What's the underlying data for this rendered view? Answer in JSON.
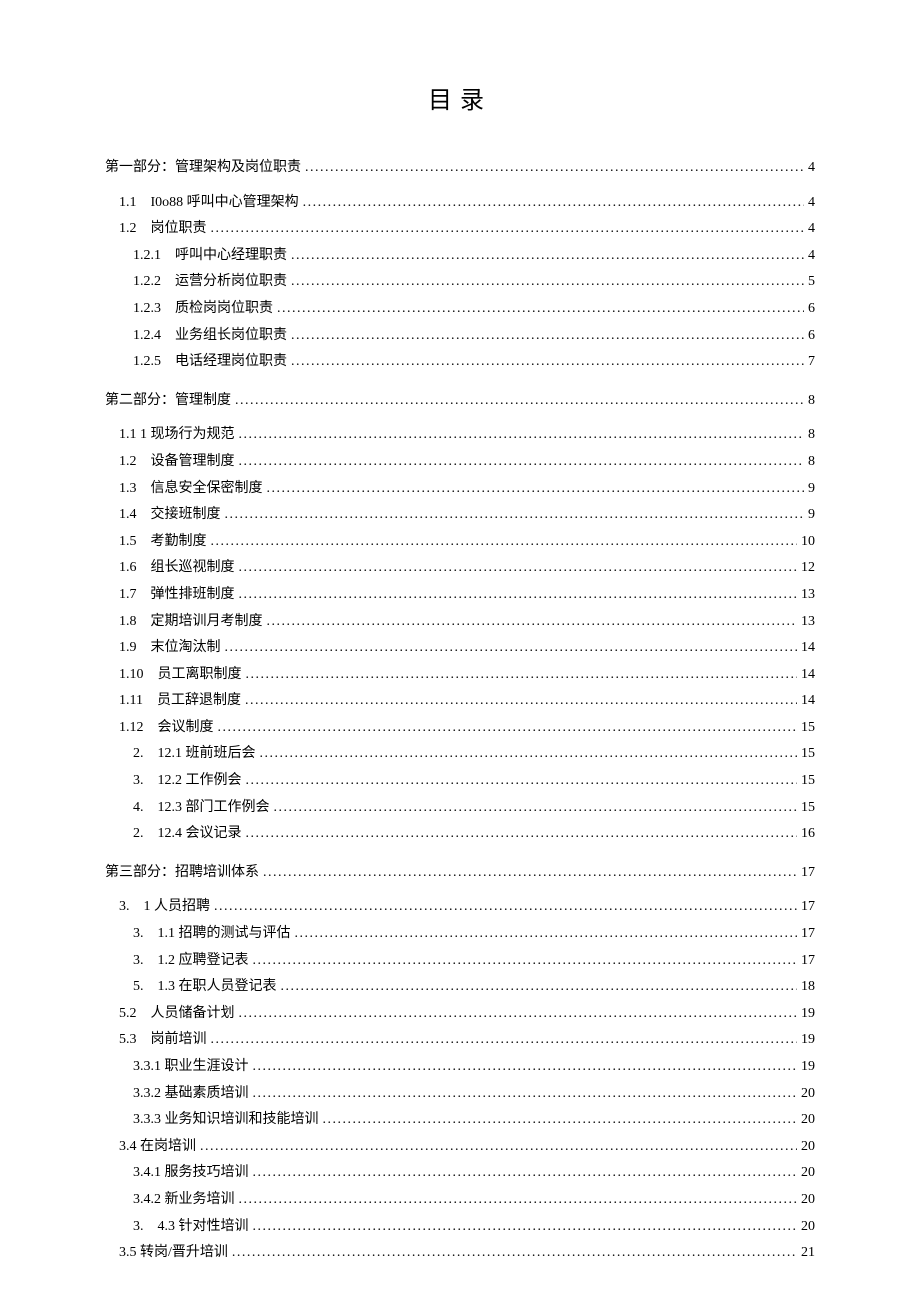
{
  "title": "目录",
  "toc": [
    {
      "level": 0,
      "label": "第一部分：管理架构及岗位职责",
      "page": "4"
    },
    {
      "level": 1,
      "label": "1.1　I0o88 呼叫中心管理架构",
      "page": "4"
    },
    {
      "level": 1,
      "label": "1.2　岗位职责",
      "page": "4"
    },
    {
      "level": 2,
      "label": "1.2.1　呼叫中心经理职责",
      "page": "4"
    },
    {
      "level": 2,
      "label": "1.2.2　运营分析岗位职责",
      "page": "5"
    },
    {
      "level": 2,
      "label": "1.2.3　质检岗岗位职责",
      "page": "6"
    },
    {
      "level": 2,
      "label": "1.2.4　业务组长岗位职责",
      "page": "6"
    },
    {
      "level": 2,
      "label": "1.2.5　电话经理岗位职责",
      "page": "7"
    },
    {
      "level": 0,
      "label": "第二部分：管理制度",
      "page": "8"
    },
    {
      "level": 1,
      "label": "1.1 1 现场行为规范",
      "page": "8"
    },
    {
      "level": 1,
      "label": "1.2　设备管理制度",
      "page": "8"
    },
    {
      "level": 1,
      "label": "1.3　信息安全保密制度",
      "page": "9"
    },
    {
      "level": 1,
      "label": "1.4　交接班制度",
      "page": "9"
    },
    {
      "level": 1,
      "label": "1.5　考勤制度",
      "page": "10"
    },
    {
      "level": 1,
      "label": "1.6　组长巡视制度",
      "page": "12"
    },
    {
      "level": 1,
      "label": "1.7　弹性排班制度",
      "page": "13"
    },
    {
      "level": 1,
      "label": "1.8　定期培训月考制度",
      "page": "13"
    },
    {
      "level": 1,
      "label": "1.9　末位淘汰制",
      "page": "14"
    },
    {
      "level": 1,
      "label": "1.10　员工离职制度",
      "page": "14"
    },
    {
      "level": 1,
      "label": "1.11　员工辞退制度",
      "page": "14"
    },
    {
      "level": 1,
      "label": "1.12　会议制度",
      "page": "15"
    },
    {
      "level": 2,
      "label": "2.　12.1 班前班后会",
      "page": "15"
    },
    {
      "level": 2,
      "label": "3.　12.2 工作例会",
      "page": "15"
    },
    {
      "level": 2,
      "label": "4.　12.3 部门工作例会",
      "page": "15"
    },
    {
      "level": 2,
      "label": "2.　12.4 会议记录",
      "page": "16"
    },
    {
      "level": 0,
      "label": "第三部分：招聘培训体系",
      "page": "17"
    },
    {
      "level": 1,
      "label": "3.　1 人员招聘",
      "page": "17"
    },
    {
      "level": 2,
      "label": "3.　1.1 招聘的测试与评估",
      "page": "17"
    },
    {
      "level": 2,
      "label": "3.　1.2 应聘登记表",
      "page": "17"
    },
    {
      "level": 2,
      "label": "5.　1.3 在职人员登记表",
      "page": "18"
    },
    {
      "level": 1,
      "label": "5.2　人员储备计划",
      "page": "19"
    },
    {
      "level": 1,
      "label": "5.3　岗前培训",
      "page": "19"
    },
    {
      "level": 2,
      "label": "3.3.1 职业生涯设计",
      "page": "19"
    },
    {
      "level": 2,
      "label": "3.3.2 基础素质培训",
      "page": "20"
    },
    {
      "level": 2,
      "label": "3.3.3 业务知识培训和技能培训",
      "page": "20"
    },
    {
      "level": 1,
      "label": "3.4 在岗培训",
      "page": "20"
    },
    {
      "level": 2,
      "label": "3.4.1 服务技巧培训",
      "page": "20"
    },
    {
      "level": 2,
      "label": "3.4.2 新业务培训",
      "page": "20"
    },
    {
      "level": 2,
      "label": "3.　4.3 针对性培训",
      "page": "20"
    },
    {
      "level": 1,
      "label": "3.5 转岗/晋升培训",
      "page": "21"
    }
  ]
}
